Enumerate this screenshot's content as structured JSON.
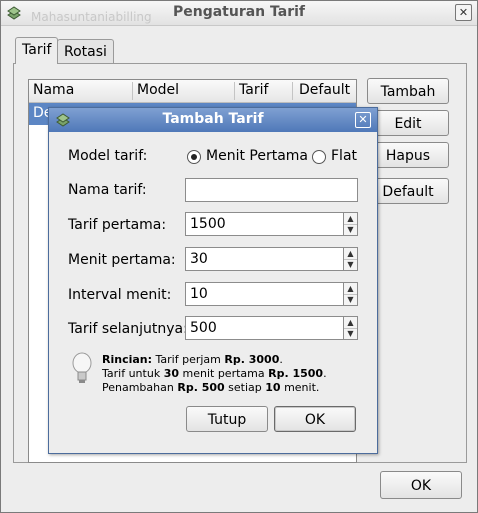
{
  "window": {
    "title": "Pengaturan Tarif",
    "bg_text": "Mahasuntaniabilling"
  },
  "tabs": [
    {
      "label": "Tarif"
    },
    {
      "label": "Rotasi"
    }
  ],
  "table": {
    "columns": [
      "Nama",
      "Model",
      "Tarif",
      "Default"
    ],
    "rows": [
      {
        "nama": "De"
      }
    ]
  },
  "side_buttons": {
    "add": "Tambah",
    "edit": "Edit",
    "delete": "Hapus",
    "default": "Default"
  },
  "ok_label": "OK",
  "dialog": {
    "title": "Tambah Tarif",
    "model_label": "Model tarif:",
    "model_options": [
      "Menit Pertama",
      "Flat"
    ],
    "model_selected": "Menit Pertama",
    "name_label": "Nama tarif:",
    "name_value": "",
    "first_rate_label": "Tarif pertama:",
    "first_rate_value": "1500",
    "first_minutes_label": "Menit pertama:",
    "first_minutes_value": "30",
    "interval_label": "Interval menit:",
    "interval_value": "10",
    "next_rate_label": "Tarif selanjutnya:",
    "next_rate_value": "500",
    "detail_line1_bold": "Rincian:",
    "detail_line1_text": "Tarif perjam",
    "detail_line1_value": "Rp. 3000",
    "detail_line2_pre": "Tarif untuk",
    "detail_line2_bold1": "30",
    "detail_line2_mid": "menit pertama",
    "detail_line2_bold2": "Rp. 1500",
    "detail_line3_pre": "Penambahan",
    "detail_line3_bold1": "Rp. 500",
    "detail_line3_mid": "setiap",
    "detail_line3_bold2": "10",
    "detail_line3_post": "menit.",
    "close_button": "Tutup",
    "ok_button": "OK"
  }
}
